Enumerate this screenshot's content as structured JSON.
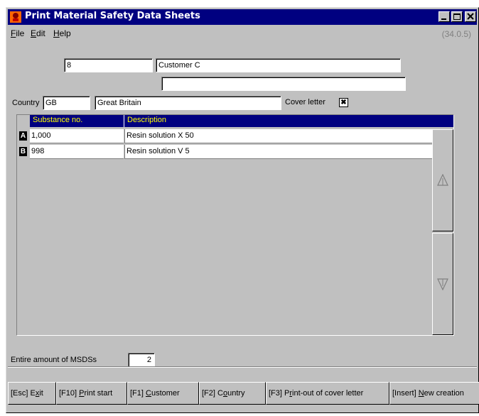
{
  "window": {
    "title": "Print Material Safety Data Sheets",
    "version": "(34.0.5)"
  },
  "menu": [
    {
      "label": "File",
      "mnemonic": "F",
      "rest": "ile"
    },
    {
      "label": "Edit",
      "mnemonic": "E",
      "rest": "dit"
    },
    {
      "label": "Help",
      "mnemonic": "H",
      "rest": "elp"
    }
  ],
  "customer": {
    "number": "8",
    "name": "Customer C",
    "name2": ""
  },
  "country": {
    "label": "Country",
    "code": "GB",
    "name": "Great Britain"
  },
  "cover_letter": {
    "label": "Cover letter",
    "checked": true,
    "mark": "✖"
  },
  "grid": {
    "columns": [
      "Substance no.",
      "Description"
    ],
    "rows": [
      {
        "marker": "A",
        "substance": "1,000",
        "description": "Resin solution  X 50"
      },
      {
        "marker": "B",
        "substance": "998",
        "description": "Resin solution  V 5"
      }
    ]
  },
  "total": {
    "label": "Entire amount of MSDSs",
    "value": "2"
  },
  "fkeys": [
    {
      "pre": "[Esc] E",
      "u": "x",
      "post": "it"
    },
    {
      "pre": "[F10] ",
      "u": "P",
      "post": "rint start"
    },
    {
      "pre": "[F1] ",
      "u": "C",
      "post": "ustomer"
    },
    {
      "pre": "[F2] C",
      "u": "o",
      "post": "untry"
    },
    {
      "pre": "[F3] P",
      "u": "r",
      "post": "int-out of cover letter"
    },
    {
      "pre": "[Insert] ",
      "u": "N",
      "post": "ew creation"
    }
  ],
  "colors": {
    "titlebar": "#000080",
    "header_text": "#ffff00",
    "face": "#c0c0c0"
  }
}
